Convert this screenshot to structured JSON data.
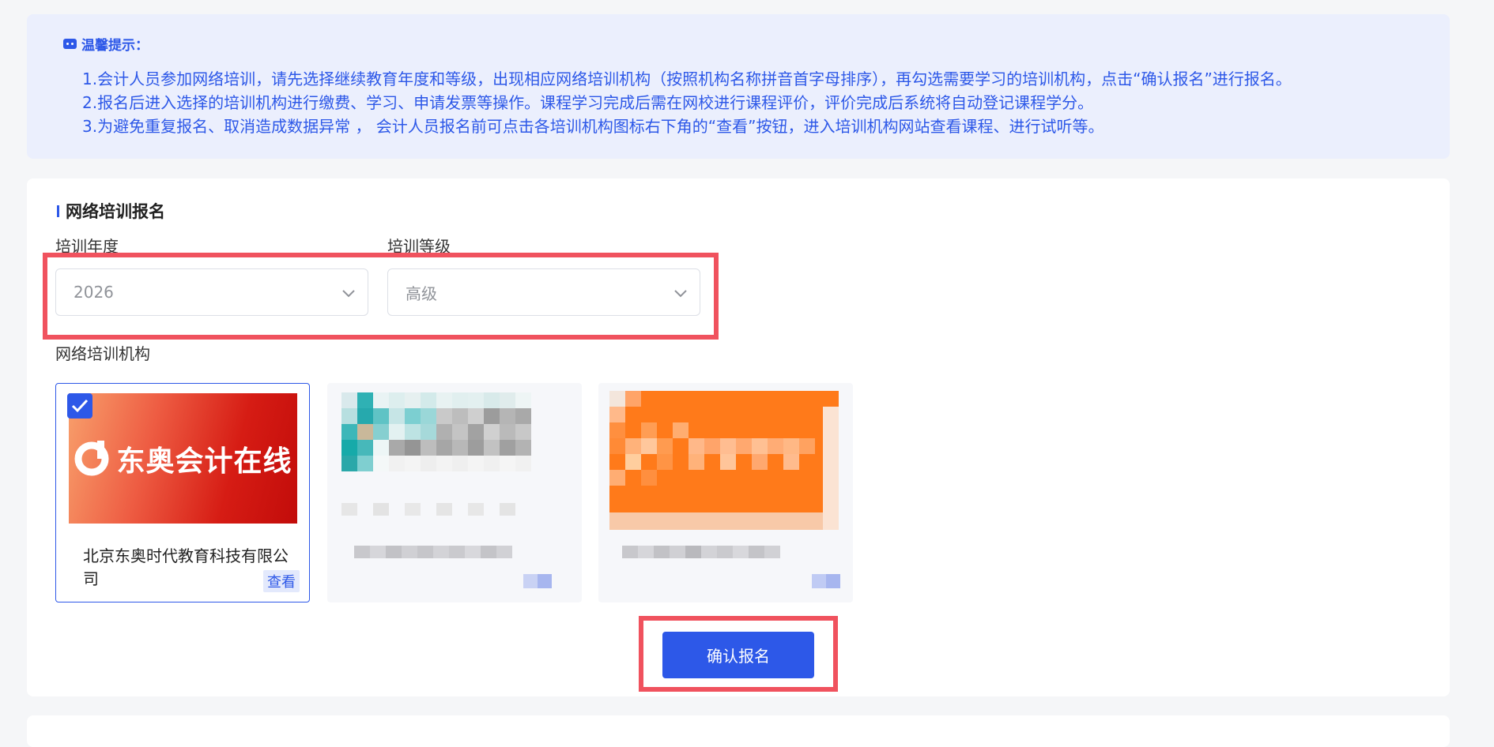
{
  "notice": {
    "title": "温馨提示：",
    "lines": [
      "1.会计人员参加网络培训，请先选择继续教育年度和等级，出现相应网络培训机构（按照机构名称拼音首字母排序），再勾选需要学习的培训机构，点击“确认报名”进行报名。",
      "2.报名后进入选择的培训机构进行缴费、学习、申请发票等操作。课程学习完成后需在网校进行课程评价，评价完成后系统将自动登记课程学分。",
      "3.为避免重复报名、取消造成数据异常 ， 会计人员报名前可点击各培训机构图标右下角的“查看”按钮，进入培训机构网站查看课程、进行试听等。"
    ]
  },
  "section": {
    "title": "网络培训报名"
  },
  "form": {
    "year_label": "培训年度",
    "year_value": "2026",
    "level_label": "培训等级",
    "level_value": "高级",
    "institutions_label": "网络培训机构"
  },
  "institutions": [
    {
      "logo_text": "东奥会计在线",
      "name": "北京东奥时代教育科技有限公司",
      "view_label": "查看",
      "selected": true
    },
    {
      "blurred": true,
      "selected": false
    },
    {
      "blurred": true,
      "selected": false
    }
  ],
  "confirm_button": "确认报名",
  "colors": {
    "accent": "#2d58e8",
    "annotation": "#f0525e",
    "notice_bg": "#ebeffd"
  }
}
